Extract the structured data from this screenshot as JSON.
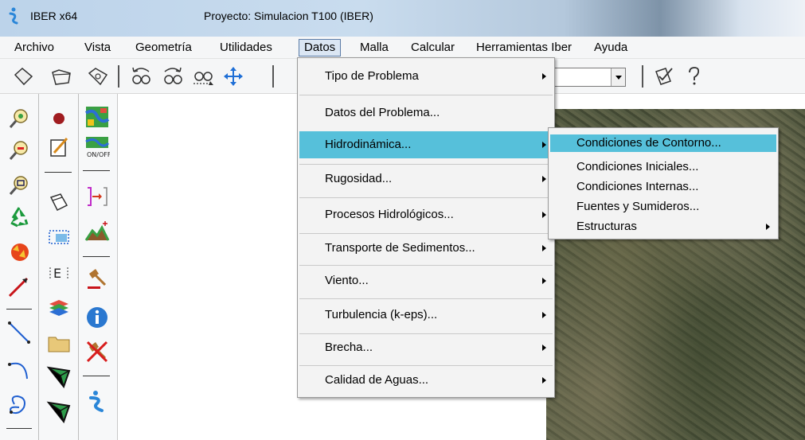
{
  "window": {
    "app_title": "IBER x64",
    "project_title": "Proyecto: Simulacion T100 (IBER)"
  },
  "menubar": {
    "items": [
      "Archivo",
      "Vista",
      "Geometría",
      "Utilidades",
      "Datos",
      "Malla",
      "Calcular",
      "Herramientas Iber",
      "Ayuda"
    ],
    "active": "Datos"
  },
  "toolbar": {
    "icons": [
      "new-icon",
      "open-folder-icon",
      "save-disk-icon",
      "rotate-left-icon",
      "rotate-right-icon",
      "zoom-view-icon",
      "pan-icon",
      "checklist-icon",
      "help-question-icon"
    ],
    "combo_value": ""
  },
  "datos_menu": {
    "items": [
      {
        "label": "Tipo de Problema",
        "submenu": true
      },
      {
        "label": "Datos del Problema...",
        "submenu": false
      },
      {
        "label": "Hidrodinámica...",
        "submenu": true,
        "highlighted": true
      },
      {
        "label": "Rugosidad...",
        "submenu": true
      },
      {
        "label": "Procesos Hidrológicos...",
        "submenu": true
      },
      {
        "label": "Transporte de Sedimentos...",
        "submenu": true
      },
      {
        "label": "Viento...",
        "submenu": true
      },
      {
        "label": "Turbulencia (k-eps)...",
        "submenu": true
      },
      {
        "label": "Brecha...",
        "submenu": true
      },
      {
        "label": "Calidad de Aguas...",
        "submenu": true
      }
    ]
  },
  "hidrodinamica_submenu": {
    "items": [
      {
        "label": "Condiciones de Contorno...",
        "highlighted": true
      },
      {
        "label": "Condiciones Iniciales..."
      },
      {
        "label": "Condiciones Internas..."
      },
      {
        "label": "Fuentes y Sumideros..."
      },
      {
        "label": "Estructuras",
        "submenu": true
      }
    ]
  },
  "colors": {
    "highlight": "#56c0da",
    "menu_bg": "#f3f3f3"
  }
}
